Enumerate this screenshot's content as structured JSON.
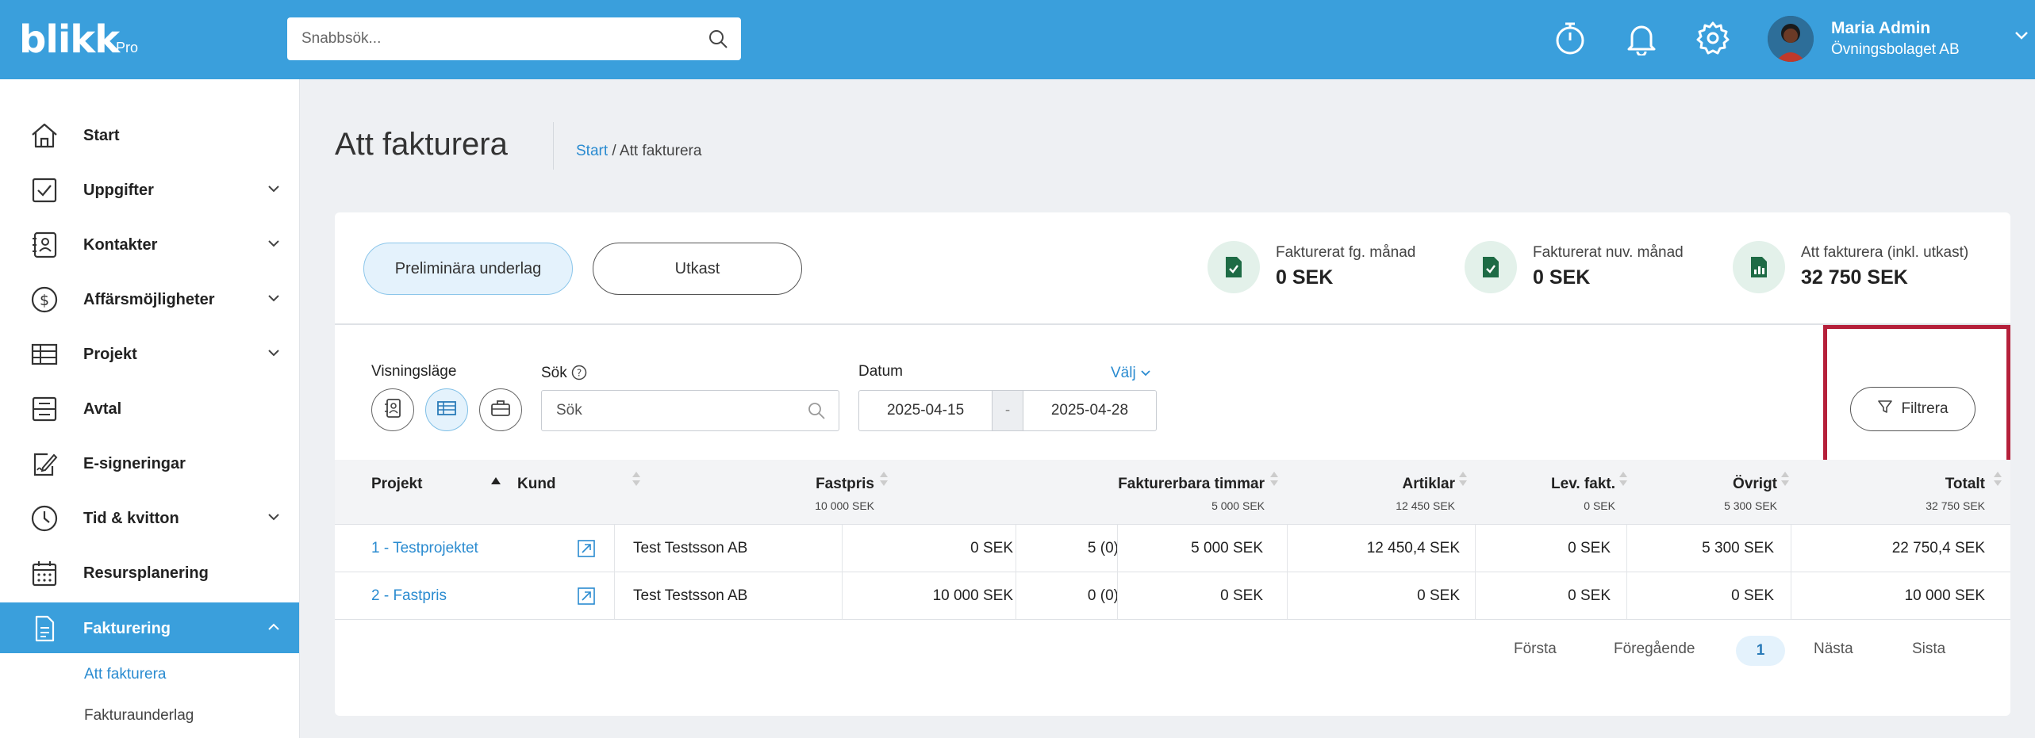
{
  "app": {
    "logo": "blikk",
    "logo_sub": "Pro",
    "search_placeholder": "Snabbsök...",
    "user_name": "Maria Admin",
    "user_org": "Övningsbolaget AB",
    "accent": "#3a9fdc"
  },
  "sidebar": {
    "items": [
      {
        "label": "Start",
        "icon": "home-icon"
      },
      {
        "label": "Uppgifter",
        "icon": "checkbox-icon"
      },
      {
        "label": "Kontakter",
        "icon": "contact-icon"
      },
      {
        "label": "Affärsmöjligheter",
        "icon": "dollar-icon"
      },
      {
        "label": "Projekt",
        "icon": "table-icon"
      },
      {
        "label": "Avtal",
        "icon": "contract-icon"
      },
      {
        "label": "E-signeringar",
        "icon": "signature-icon"
      },
      {
        "label": "Tid & kvitton",
        "icon": "clock-icon"
      },
      {
        "label": "Resursplanering",
        "icon": "calendar-icon"
      },
      {
        "label": "Fakturering",
        "icon": "document-icon"
      }
    ],
    "sub_items": [
      "Att fakturera",
      "Fakturaunderlag"
    ]
  },
  "page": {
    "title": "Att fakturera",
    "breadcrumb_start": "Start",
    "breadcrumb_sep": " / ",
    "breadcrumb_current": "Att fakturera"
  },
  "tabs": {
    "preliminary": "Preliminära underlag",
    "draft": "Utkast"
  },
  "stats": [
    {
      "label": "Fakturerat fg. månad",
      "value": "0 SEK"
    },
    {
      "label": "Fakturerat nuv. månad",
      "value": "0 SEK"
    },
    {
      "label": "Att fakturera (inkl. utkast)",
      "value": "32 750 SEK"
    }
  ],
  "filters": {
    "view_label": "Visningsläge",
    "search_label": "Sök",
    "search_placeholder": "Sök",
    "date_label": "Datum",
    "date_choose": "Välj",
    "date_from": "2025-04-15",
    "date_sep": "-",
    "date_to": "2025-04-28",
    "filter_button": "Filtrera"
  },
  "table": {
    "headers": {
      "project": "Projekt",
      "customer": "Kund",
      "fixed": "Fastpris",
      "fixed_sub": "10 000 SEK",
      "hours": "Fakturerbara timmar",
      "hours_sub": "5 000 SEK",
      "articles": "Artiklar",
      "articles_sub": "12 450 SEK",
      "supplier": "Lev. fakt.",
      "supplier_sub": "0 SEK",
      "other": "Övrigt",
      "other_sub": "5 300 SEK",
      "total": "Totalt",
      "total_sub": "32 750 SEK"
    },
    "rows": [
      {
        "project": "1 - Testprojektet",
        "customer": "Test Testsson AB",
        "fixed": "0 SEK",
        "hours_qty": "5 (0)",
        "hours": "5 000 SEK",
        "articles": "12 450,4 SEK",
        "supplier": "0 SEK",
        "other": "5 300 SEK",
        "total": "22 750,4 SEK"
      },
      {
        "project": "2 - Fastpris",
        "customer": "Test Testsson AB",
        "fixed": "10 000 SEK",
        "hours_qty": "0 (0)",
        "hours": "0 SEK",
        "articles": "0 SEK",
        "supplier": "0 SEK",
        "other": "0 SEK",
        "total": "10 000 SEK"
      }
    ]
  },
  "pagination": {
    "first": "Första",
    "prev": "Föregående",
    "current": "1",
    "next": "Nästa",
    "last": "Sista"
  }
}
